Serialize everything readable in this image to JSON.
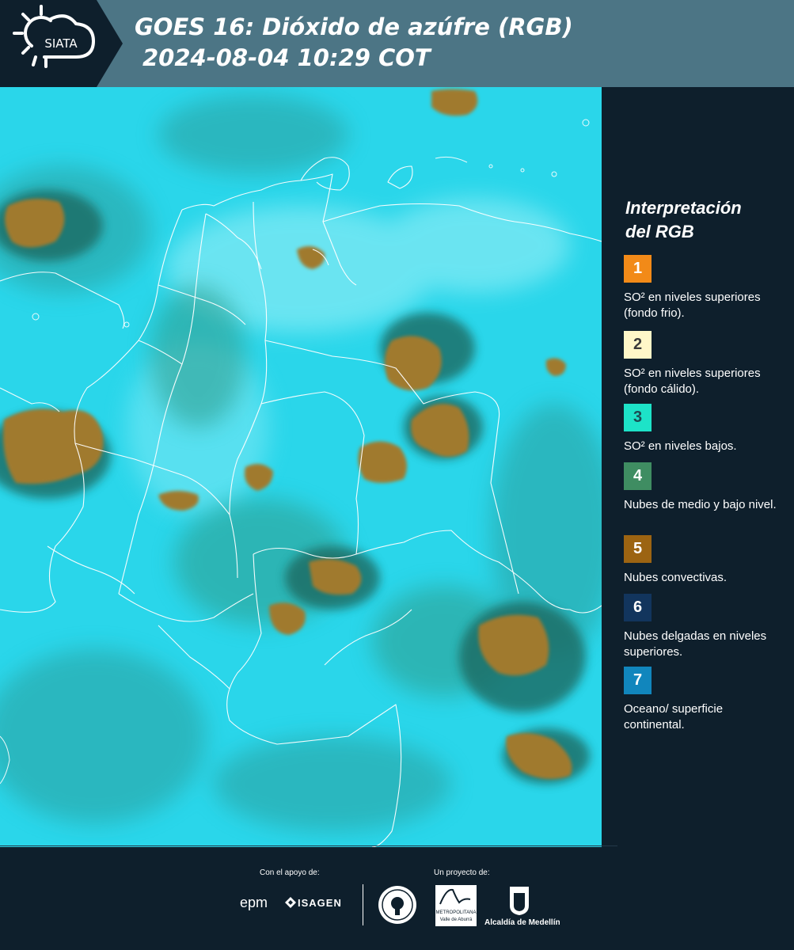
{
  "header": {
    "logo_text": "SIATA",
    "title_line1": "GOES 16: Dióxido de azúfre (RGB)",
    "title_line2": "2024-08-04 10:29 COT",
    "background_color": "#4c7585"
  },
  "map": {
    "icon": "satellite-rgb-map",
    "ocean_color": "#2ad6ea",
    "cloud_color": "#a07a2e"
  },
  "legend": {
    "title_line1": "Interpretación",
    "title_line2": "del RGB",
    "items": [
      {
        "number": "1",
        "text": "SO² en niveles superiores (fondo frio).",
        "color": "#f28a18"
      },
      {
        "number": "2",
        "text": "SO² en niveles superiores (fondo cálido).",
        "color": "#fff7c8"
      },
      {
        "number": "3",
        "text": "SO² en niveles bajos.",
        "color": "#1de3c8"
      },
      {
        "number": "4",
        "text": "Nubes de medio y bajo nivel.",
        "color": "#3f8d62"
      },
      {
        "number": "5",
        "text": "Nubes convectivas.",
        "color": "#9c6412"
      },
      {
        "number": "6",
        "text": "Nubes delgadas en niveles superiores.",
        "color": "#12355d"
      },
      {
        "number": "7",
        "text": "Oceano/ superficie continental.",
        "color": "#1186bd"
      }
    ]
  },
  "footer": {
    "support_label": "Con el apoyo de:",
    "project_label": "Un proyecto de:",
    "epm": "epm",
    "isagen": "ISAGEN",
    "area_line1": "METROPOLITANA",
    "area_line2": "Valle de Aburrá",
    "alcaldia": "Alcaldía de Medellín"
  }
}
